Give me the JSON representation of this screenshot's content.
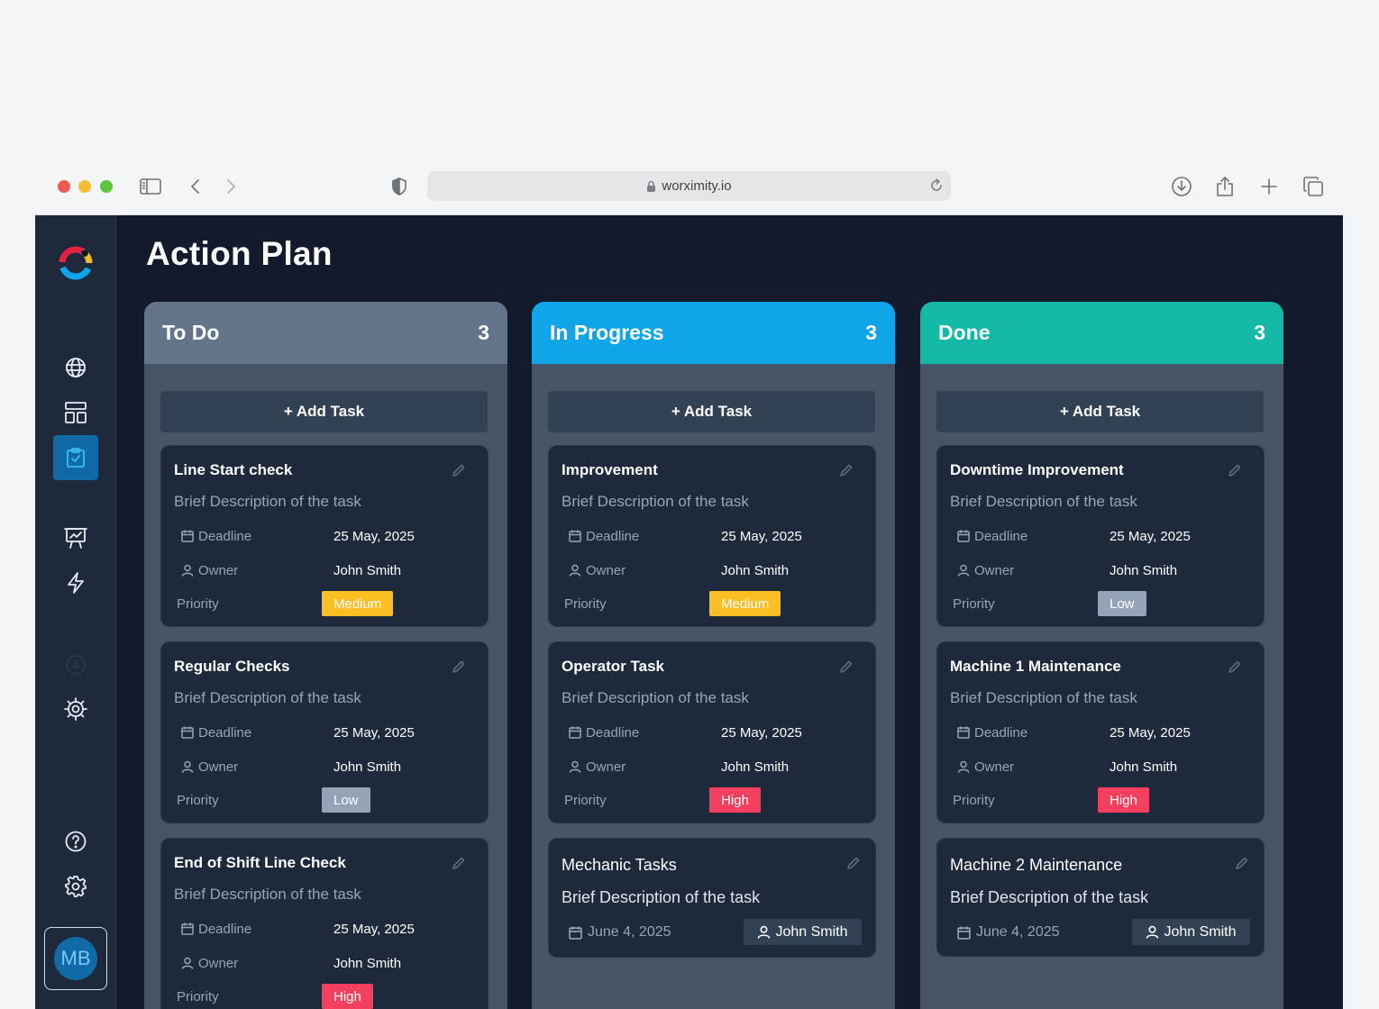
{
  "browser": {
    "url": "worximity.io"
  },
  "page": {
    "title": "Action Plan"
  },
  "user": {
    "initials": "MB"
  },
  "colors": {
    "todo_header": "#64748b",
    "in_progress_header": "#0ea5e9",
    "done_header": "#14b8a6",
    "priority_medium": "#fbbf24",
    "priority_low": "#94a3b8",
    "priority_high": "#f43f5e"
  },
  "labels": {
    "add_task": "+ Add Task",
    "deadline": "Deadline",
    "owner": "Owner",
    "priority": "Priority"
  },
  "columns": [
    {
      "title": "To Do",
      "count": "3",
      "cards": [
        {
          "title": "Line Start check",
          "description": "Brief Description of the task",
          "deadline": "25 May, 2025",
          "owner": "John Smith",
          "priority": "Medium"
        },
        {
          "title": "Regular Checks",
          "description": "Brief Description of the task",
          "deadline": "25 May, 2025",
          "owner": "John Smith",
          "priority": "Low"
        },
        {
          "title": "End of Shift Line Check",
          "description": "Brief Description of the task",
          "deadline": "25 May, 2025",
          "owner": "John Smith",
          "priority": "High"
        }
      ]
    },
    {
      "title": "In Progress",
      "count": "3",
      "cards": [
        {
          "title": "Improvement",
          "description": "Brief Description of the task",
          "deadline": "25 May, 2025",
          "owner": "John Smith",
          "priority": "Medium"
        },
        {
          "title": "Operator Task",
          "description": "Brief Description of the task",
          "deadline": "25 May, 2025",
          "owner": "John Smith",
          "priority": "High"
        },
        {
          "title": "Mechanic Tasks",
          "description": "Brief Description of the task",
          "date": "June 4, 2025",
          "owner": "John Smith"
        }
      ]
    },
    {
      "title": "Done",
      "count": "3",
      "cards": [
        {
          "title": "Downtime Improvement",
          "description": "Brief Description of the task",
          "deadline": "25 May, 2025",
          "owner": "John Smith",
          "priority": "Low"
        },
        {
          "title": "Machine 1 Maintenance",
          "description": "Brief Description of the task",
          "deadline": "25 May, 2025",
          "owner": "John Smith",
          "priority": "High"
        },
        {
          "title": "Machine 2 Maintenance",
          "description": "Brief Description of the task",
          "date": "June 4, 2025",
          "owner": "John Smith"
        }
      ]
    }
  ]
}
